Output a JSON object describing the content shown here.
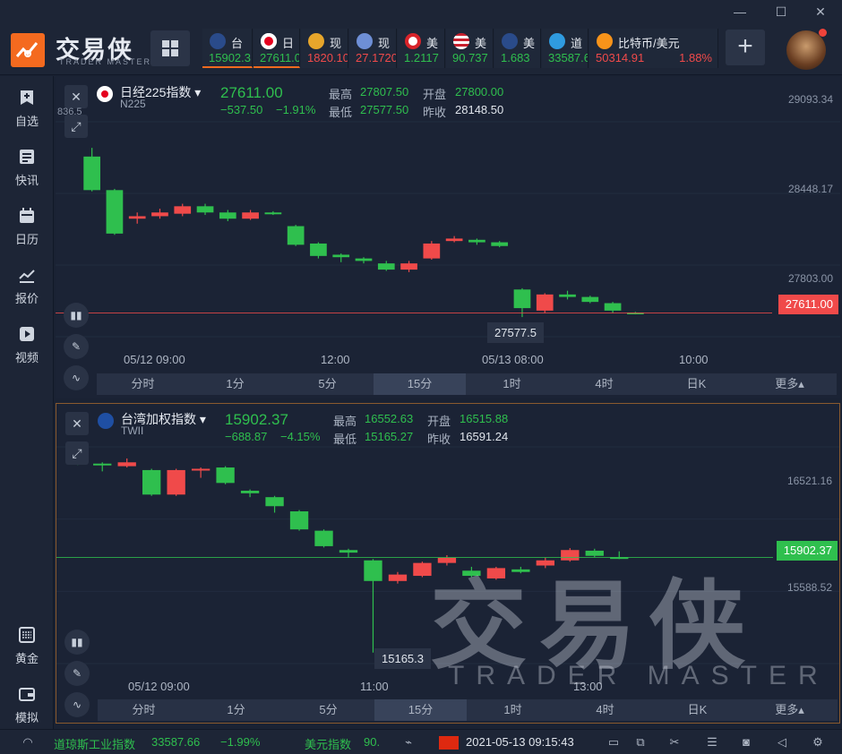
{
  "brand": {
    "name": "交易侠",
    "tagline": "TRADER MASTER",
    "accent": "#f46a1f"
  },
  "window_controls": {
    "minimize": "—",
    "maximize": "☐",
    "close": "✕"
  },
  "tickers": [
    {
      "name": "台",
      "price": "15902.3",
      "pct": "",
      "trend": "green",
      "icon": "bar-chart-icon",
      "active": true
    },
    {
      "name": "日",
      "price": "27611.0",
      "pct": "",
      "trend": "green",
      "icon": "japan-flag-icon",
      "active": true
    },
    {
      "name": "现",
      "price": "1820.10",
      "pct": "",
      "trend": "red",
      "icon": "gold-icon",
      "active": false
    },
    {
      "name": "现",
      "price": "27.1720",
      "pct": "",
      "trend": "red",
      "icon": "silver-icon",
      "active": false
    },
    {
      "name": "美",
      "price": "1.2117",
      "pct": "",
      "trend": "green",
      "icon": "canada-flag-icon",
      "active": false
    },
    {
      "name": "美",
      "price": "90.737",
      "pct": "",
      "trend": "green",
      "icon": "usa-flag-icon",
      "active": false
    },
    {
      "name": "美",
      "price": "1.683",
      "pct": "",
      "trend": "green",
      "icon": "bar-chart-icon",
      "active": false
    },
    {
      "name": "道",
      "price": "33587.6",
      "pct": "",
      "trend": "green",
      "icon": "dow-icon",
      "active": false
    },
    {
      "name": "比特币/美元",
      "price": "50314.91",
      "pct": "1.88%",
      "trend": "red",
      "icon": "bitcoin-icon",
      "active": false
    }
  ],
  "add_label": "+",
  "sidebar": {
    "items": [
      {
        "label": "自选",
        "icon": "bookmark-icon"
      },
      {
        "label": "快讯",
        "icon": "news-icon"
      },
      {
        "label": "日历",
        "icon": "calendar-icon"
      },
      {
        "label": "报价",
        "icon": "quote-chart-icon"
      },
      {
        "label": "视频",
        "icon": "video-icon"
      }
    ],
    "bottom_items": [
      {
        "label": "黄金",
        "icon": "abacus-icon"
      },
      {
        "label": "模拟",
        "icon": "wallet-icon"
      }
    ]
  },
  "timeframes": [
    "分时",
    "1分",
    "5分",
    "15分",
    "1时",
    "4时",
    "日K",
    "更多▴"
  ],
  "active_timeframe": "15分",
  "panel_top": {
    "title": "日经225指数 ▾",
    "symbol": "N225",
    "price": "27611.00",
    "change": "−537.50",
    "change_pct": "−1.91%",
    "high_label": "最高",
    "high": "27807.50",
    "open_label": "开盘",
    "open": "27800.00",
    "low_label": "最低",
    "low": "27577.50",
    "prev_label": "昨收",
    "prev": "28148.50",
    "y_ticks": [
      "29093.34",
      "28448.17",
      "27803.00"
    ],
    "partial_y": "836.5",
    "current_tag": "27611.00",
    "low_tip": "27577.5",
    "x_ticks": [
      "05/12 09:00",
      "12:00",
      "05/13 08:00",
      "10:00"
    ]
  },
  "panel_bottom": {
    "title": "台湾加权指数 ▾",
    "symbol": "TWII",
    "price": "15902.37",
    "change": "−688.87",
    "change_pct": "−4.15%",
    "high_label": "最高",
    "high": "16552.63",
    "open_label": "开盘",
    "open": "16515.88",
    "low_label": "最低",
    "low": "15165.27",
    "prev_label": "昨收",
    "prev": "16591.24",
    "y_ticks": [
      "16521.16",
      "15588.52"
    ],
    "current_tag": "15902.37",
    "low_tip": "15165.3",
    "x_ticks": [
      "05/12 09:00",
      "11:00",
      "13:00"
    ]
  },
  "chart_data": [
    {
      "type": "candlestick",
      "title": "日经225指数",
      "timeframe": "15分",
      "x_ticks": [
        "05/12 09:00",
        "12:00",
        "05/13 08:00",
        "10:00"
      ],
      "ylim": [
        27420,
        29150
      ],
      "y_ticks": [
        29093.34,
        28448.17,
        27803.0
      ],
      "up_color": "#f04a4a",
      "down_color": "#2fbf4e",
      "candles": [
        {
          "o": 28870,
          "c": 28600,
          "h": 28940,
          "l": 28590
        },
        {
          "o": 28600,
          "c": 28250,
          "h": 28610,
          "l": 28240
        },
        {
          "o": 28370,
          "c": 28390,
          "h": 28420,
          "l": 28330
        },
        {
          "o": 28390,
          "c": 28420,
          "h": 28450,
          "l": 28370
        },
        {
          "o": 28410,
          "c": 28470,
          "h": 28490,
          "l": 28390
        },
        {
          "o": 28470,
          "c": 28420,
          "h": 28490,
          "l": 28400
        },
        {
          "o": 28420,
          "c": 28370,
          "h": 28440,
          "l": 28350
        },
        {
          "o": 28370,
          "c": 28420,
          "h": 28440,
          "l": 28360
        },
        {
          "o": 28420,
          "c": 28415,
          "h": 28430,
          "l": 28400
        },
        {
          "o": 28310,
          "c": 28160,
          "h": 28320,
          "l": 28150
        },
        {
          "o": 28170,
          "c": 28070,
          "h": 28180,
          "l": 28050
        },
        {
          "o": 28080,
          "c": 28060,
          "h": 28090,
          "l": 28020
        },
        {
          "o": 28050,
          "c": 28030,
          "h": 28060,
          "l": 28010
        },
        {
          "o": 28010,
          "c": 27960,
          "h": 28030,
          "l": 27950
        },
        {
          "o": 27960,
          "c": 28010,
          "h": 28030,
          "l": 27940
        },
        {
          "o": 28050,
          "c": 28170,
          "h": 28190,
          "l": 28040
        },
        {
          "o": 28190,
          "c": 28210,
          "h": 28230,
          "l": 28180
        },
        {
          "o": 28200,
          "c": 28180,
          "h": 28210,
          "l": 28160
        },
        {
          "o": 28180,
          "c": 28150,
          "h": 28190,
          "l": 28140
        },
        {
          "o": 27800,
          "c": 27650,
          "h": 27810,
          "l": 27578
        },
        {
          "o": 27630,
          "c": 27760,
          "h": 27770,
          "l": 27610
        },
        {
          "o": 27760,
          "c": 27740,
          "h": 27790,
          "l": 27720
        },
        {
          "o": 27740,
          "c": 27700,
          "h": 27750,
          "l": 27690
        },
        {
          "o": 27690,
          "c": 27630,
          "h": 27700,
          "l": 27610
        },
        {
          "o": 27615,
          "c": 27611,
          "h": 27620,
          "l": 27600
        }
      ]
    },
    {
      "type": "candlestick",
      "title": "台湾加权指数",
      "timeframe": "15分",
      "x_ticks": [
        "05/12 09:00",
        "11:00",
        "13:00"
      ],
      "ylim": [
        15080,
        16760
      ],
      "y_ticks": [
        16521.16,
        15588.52
      ],
      "up_color": "#f04a4a",
      "down_color": "#2fbf4e",
      "candles": [
        {
          "o": 16670,
          "c": 16630,
          "h": 16680,
          "l": 16620
        },
        {
          "o": 16630,
          "c": 16620,
          "h": 16640,
          "l": 16570
        },
        {
          "o": 16610,
          "c": 16640,
          "h": 16670,
          "l": 16600
        },
        {
          "o": 16580,
          "c": 16390,
          "h": 16590,
          "l": 16380
        },
        {
          "o": 16390,
          "c": 16580,
          "h": 16590,
          "l": 16380
        },
        {
          "o": 16580,
          "c": 16590,
          "h": 16600,
          "l": 16520
        },
        {
          "o": 16600,
          "c": 16480,
          "h": 16610,
          "l": 16470
        },
        {
          "o": 16420,
          "c": 16400,
          "h": 16430,
          "l": 16370
        },
        {
          "o": 16370,
          "c": 16300,
          "h": 16380,
          "l": 16250
        },
        {
          "o": 16260,
          "c": 16120,
          "h": 16270,
          "l": 16110
        },
        {
          "o": 16110,
          "c": 15990,
          "h": 16120,
          "l": 15980
        },
        {
          "o": 15960,
          "c": 15940,
          "h": 15970,
          "l": 15900
        },
        {
          "o": 15880,
          "c": 15720,
          "h": 15890,
          "l": 15165
        },
        {
          "o": 15720,
          "c": 15770,
          "h": 15790,
          "l": 15700
        },
        {
          "o": 15760,
          "c": 15860,
          "h": 15870,
          "l": 15750
        },
        {
          "o": 15860,
          "c": 15900,
          "h": 15920,
          "l": 15840
        },
        {
          "o": 15800,
          "c": 15760,
          "h": 15830,
          "l": 15750
        },
        {
          "o": 15740,
          "c": 15820,
          "h": 15830,
          "l": 15730
        },
        {
          "o": 15810,
          "c": 15790,
          "h": 15830,
          "l": 15780
        },
        {
          "o": 15840,
          "c": 15880,
          "h": 15900,
          "l": 15820
        },
        {
          "o": 15880,
          "c": 15960,
          "h": 15975,
          "l": 15870
        },
        {
          "o": 15955,
          "c": 15915,
          "h": 15970,
          "l": 15905
        },
        {
          "o": 15905,
          "c": 15902,
          "h": 15950,
          "l": 15890
        }
      ]
    }
  ],
  "statusbar": {
    "item1_name": "道琼斯工业指数",
    "item1_price": "33587.66",
    "item1_pct": "−1.99%",
    "item2_name": "美元指数",
    "item2_price": "90.",
    "datetime": "2021-05-13 09:15:43"
  },
  "colors": {
    "up": "#f04a4a",
    "down": "#2fbf4e",
    "panel_bg": "#1b2335",
    "focus_border": "#8a5a2e"
  }
}
